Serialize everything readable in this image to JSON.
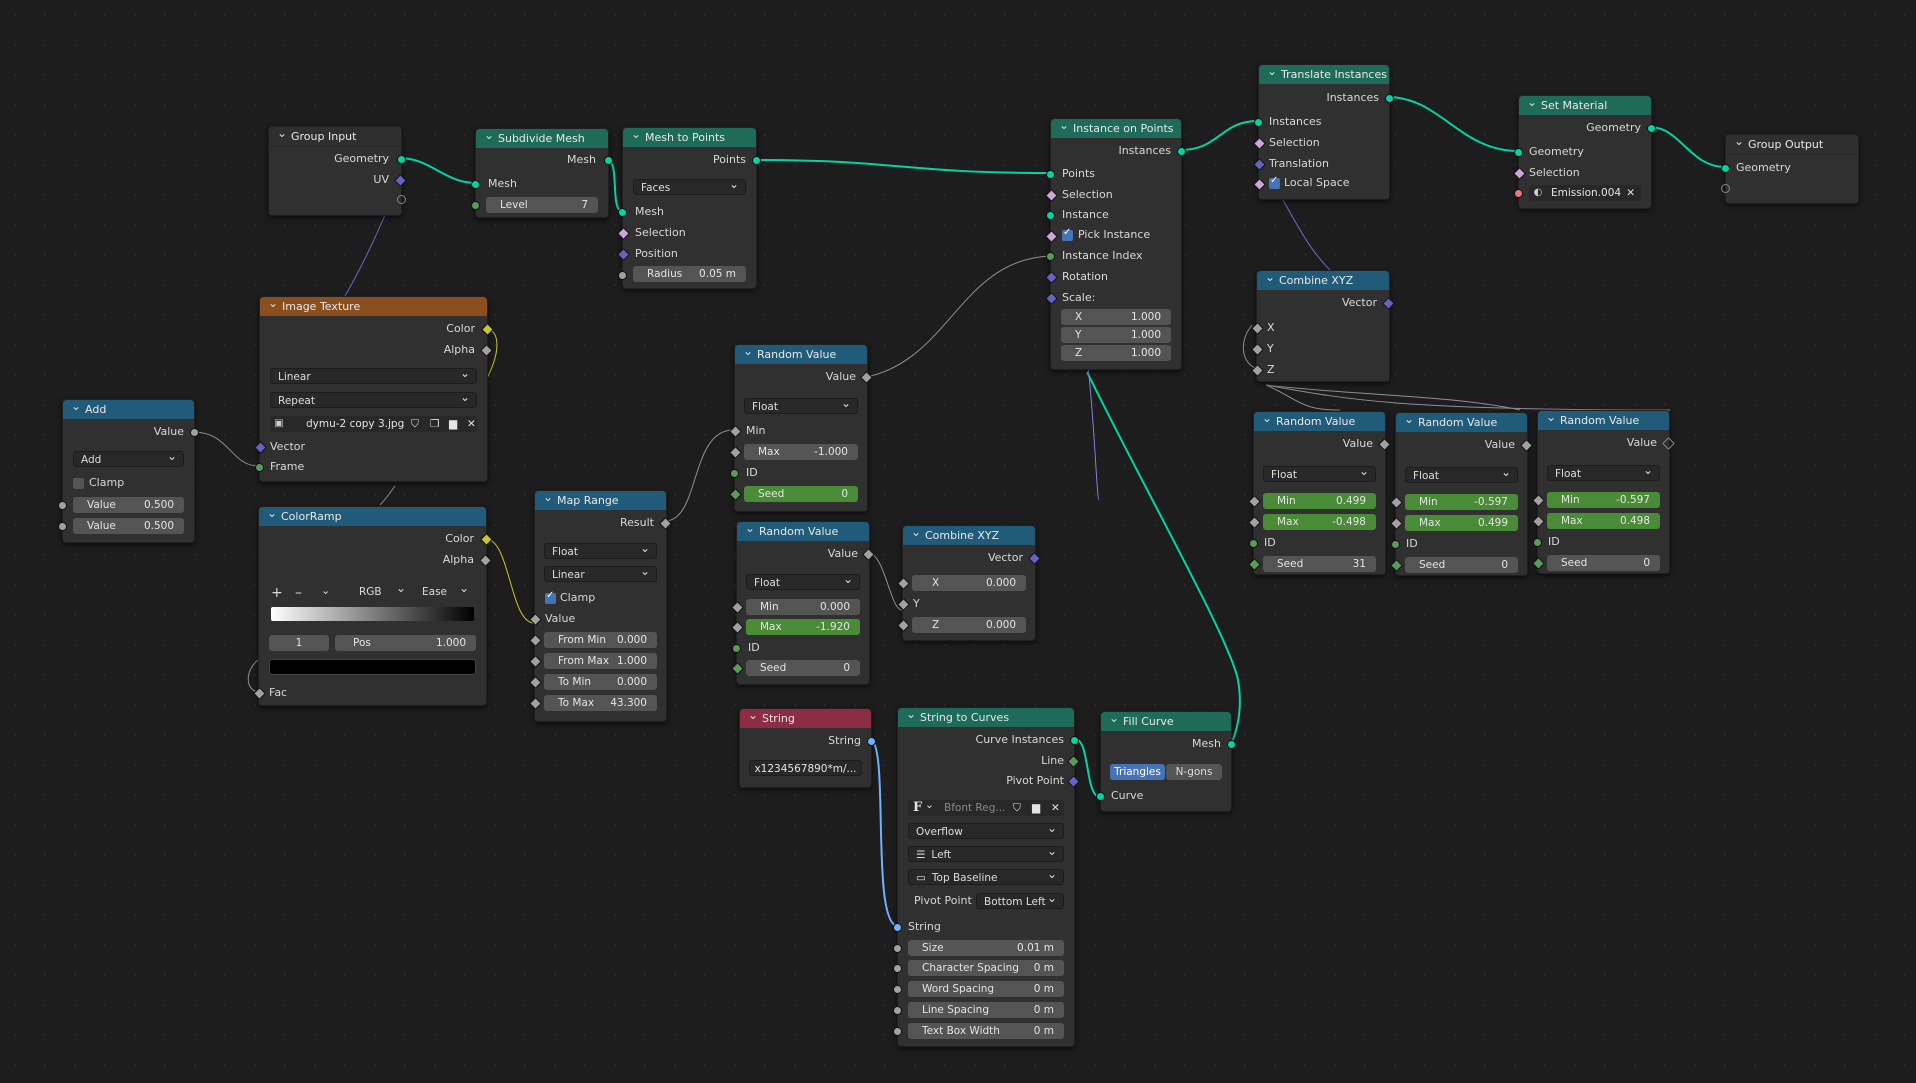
{
  "nodes": {
    "group_input": {
      "title": "Group Input",
      "geometry": "Geometry",
      "uv": "UV"
    },
    "subdivide": {
      "title": "Subdivide Mesh",
      "mesh_out": "Mesh",
      "mesh_in": "Mesh",
      "level_label": "Level",
      "level": "7"
    },
    "mesh_to_points": {
      "title": "Mesh to Points",
      "points": "Points",
      "mode": "Faces",
      "mesh": "Mesh",
      "selection": "Selection",
      "position": "Position",
      "radius_label": "Radius",
      "radius": "0.05 m"
    },
    "instance_on_points": {
      "title": "Instance on Points",
      "instances": "Instances",
      "points": "Points",
      "selection": "Selection",
      "instance": "Instance",
      "pick_instance": "Pick Instance",
      "instance_index": "Instance Index",
      "rotation": "Rotation",
      "scale": "Scale:",
      "x_label": "X",
      "x": "1.000",
      "y_label": "Y",
      "y": "1.000",
      "z_label": "Z",
      "z": "1.000"
    },
    "translate_instances": {
      "title": "Translate Instances",
      "instances_out": "Instances",
      "instances_in": "Instances",
      "selection": "Selection",
      "translation": "Translation",
      "local_space": "Local Space"
    },
    "set_material": {
      "title": "Set Material",
      "geometry_out": "Geometry",
      "geometry_in": "Geometry",
      "selection": "Selection",
      "material": "Emission.004"
    },
    "group_output": {
      "title": "Group Output",
      "geometry": "Geometry"
    },
    "image_texture": {
      "title": "Image Texture",
      "color": "Color",
      "alpha": "Alpha",
      "interp": "Linear",
      "extension": "Repeat",
      "image": "dymu-2 copy 3.jpg",
      "vector": "Vector",
      "frame": "Frame"
    },
    "add": {
      "title": "Add",
      "value_out": "Value",
      "op": "Add",
      "clamp": "Clamp",
      "v1_label": "Value",
      "v1": "0.500",
      "v2_label": "Value",
      "v2": "0.500"
    },
    "colorramp": {
      "title": "ColorRamp",
      "color": "Color",
      "alpha": "Alpha",
      "plus": "+",
      "minus": "–",
      "mode": "RGB",
      "interp": "Ease",
      "index": "1",
      "pos_label": "Pos",
      "pos": "1.000",
      "fac": "Fac"
    },
    "map_range": {
      "title": "Map Range",
      "result": "Result",
      "type": "Float",
      "interp": "Linear",
      "clamp": "Clamp",
      "value": "Value",
      "from_min_l": "From Min",
      "from_min": "0.000",
      "from_max_l": "From Max",
      "from_max": "1.000",
      "to_min_l": "To Min",
      "to_min": "0.000",
      "to_max_l": "To Max",
      "to_max": "43.300"
    },
    "random1": {
      "title": "Random Value",
      "value": "Value",
      "type": "Float",
      "min": "Min",
      "max_label": "Max",
      "max": "-1.000",
      "id": "ID",
      "seed_label": "Seed",
      "seed": "0"
    },
    "random2": {
      "title": "Random Value",
      "value": "Value",
      "type": "Float",
      "min_label": "Min",
      "min": "0.000",
      "max_label": "Max",
      "max": "-1.920",
      "id": "ID",
      "seed_label": "Seed",
      "seed": "0"
    },
    "combine1": {
      "title": "Combine XYZ",
      "vector": "Vector",
      "x_label": "X",
      "x": "0.000",
      "y": "Y",
      "z_label": "Z",
      "z": "0.000"
    },
    "combine2": {
      "title": "Combine XYZ",
      "vector": "Vector",
      "x": "X",
      "y": "Y",
      "z": "Z"
    },
    "random3": {
      "title": "Random Value",
      "value": "Value",
      "type": "Float",
      "min_label": "Min",
      "min": "0.499",
      "max_label": "Max",
      "max": "-0.498",
      "id": "ID",
      "seed_label": "Seed",
      "seed": "31"
    },
    "random4": {
      "title": "Random Value",
      "value": "Value",
      "type": "Float",
      "min_label": "Min",
      "min": "-0.597",
      "max_label": "Max",
      "max": "0.499",
      "id": "ID",
      "seed_label": "Seed",
      "seed": "0"
    },
    "random5": {
      "title": "Random Value",
      "value": "Value",
      "type": "Float",
      "min_label": "Min",
      "min": "-0.597",
      "max_label": "Max",
      "max": "0.498",
      "id": "ID",
      "seed_label": "Seed",
      "seed": "0"
    },
    "string": {
      "title": "String",
      "string": "String",
      "value": "x1234567890*m/..."
    },
    "string_to_curves": {
      "title": "String to Curves",
      "curve_instances": "Curve Instances",
      "line": "Line",
      "pivot_point": "Pivot Point",
      "font": "Bfont Reg...",
      "overflow": "Overflow",
      "align": "Left",
      "baseline": "Top Baseline",
      "pivot_label": "Pivot Point",
      "pivot": "Bottom Left",
      "string": "String",
      "size_l": "Size",
      "size": "0.01 m",
      "char_l": "Character Spacing",
      "char": "0 m",
      "word_l": "Word Spacing",
      "word": "0 m",
      "line_l": "Line Spacing",
      "line_sp": "0 m",
      "box_l": "Text Box Width",
      "box": "0 m"
    },
    "fill_curve": {
      "title": "Fill Curve",
      "mesh": "Mesh",
      "triangles": "Triangles",
      "ngons": "N-gons",
      "curve": "Curve"
    }
  },
  "colors": {
    "geometry_wire": "#00d6a3",
    "float_wire": "#8f8f8f",
    "vector_wire": "#6a6ad0",
    "color_wire": "#c7c729",
    "string_wire": "#70b2ff"
  }
}
